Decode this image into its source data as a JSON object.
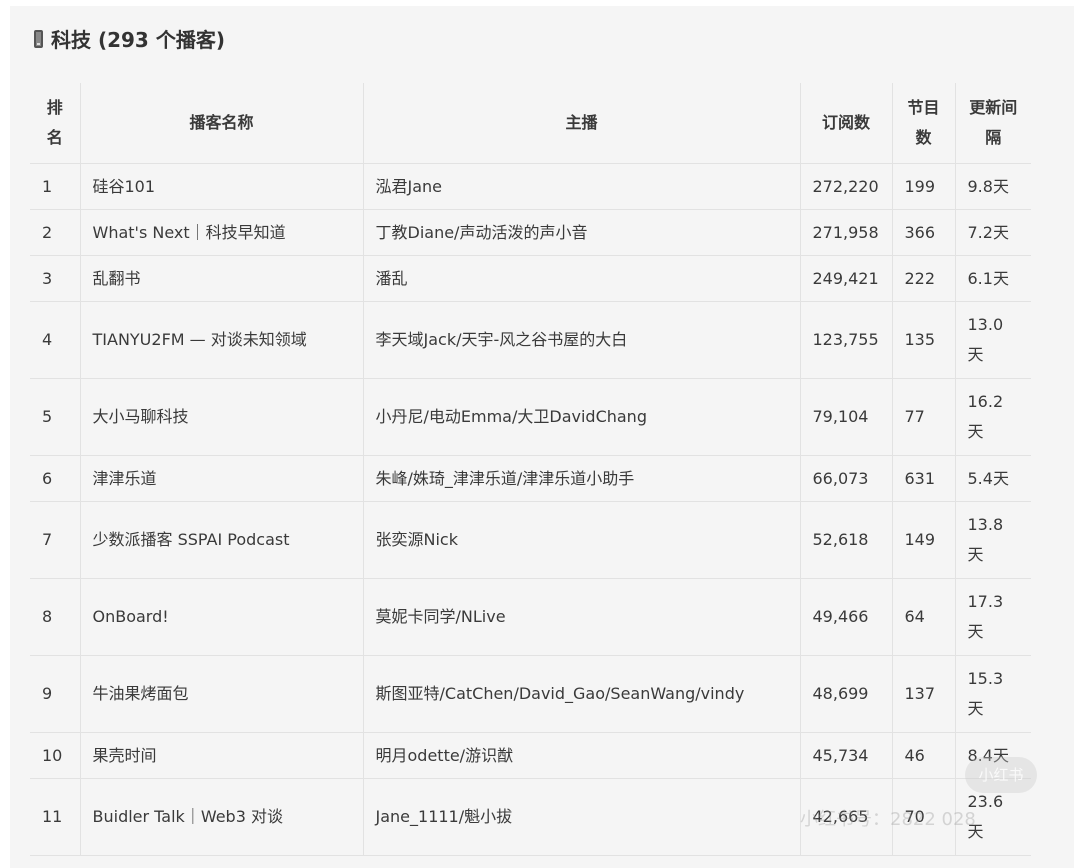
{
  "title": {
    "icon": "mobile-phone-icon",
    "text": "科技 (293 个播客)"
  },
  "table": {
    "headers": {
      "rank": "排名",
      "name": "播客名称",
      "host": "主播",
      "subscribers": "订阅数",
      "episodes": "节目数",
      "interval": "更新间隔"
    },
    "rows": [
      {
        "rank": "1",
        "name": "硅谷101",
        "host": "泓君Jane",
        "subscribers": "272,220",
        "episodes": "199",
        "interval": "9.8天"
      },
      {
        "rank": "2",
        "name": "What's Next｜科技早知道",
        "host": "丁教Diane/声动活泼的声小音",
        "subscribers": "271,958",
        "episodes": "366",
        "interval": "7.2天"
      },
      {
        "rank": "3",
        "name": "乱翻书",
        "host": "潘乱",
        "subscribers": "249,421",
        "episodes": "222",
        "interval": "6.1天"
      },
      {
        "rank": "4",
        "name": "TIANYU2FM — 对谈未知领域",
        "host": "李天域Jack/天宇-风之谷书屋的大白",
        "subscribers": "123,755",
        "episodes": "135",
        "interval": "13.0天"
      },
      {
        "rank": "5",
        "name": "大小马聊科技",
        "host": "小丹尼/电动Emma/大卫DavidChang",
        "subscribers": "79,104",
        "episodes": "77",
        "interval": "16.2天"
      },
      {
        "rank": "6",
        "name": "津津乐道",
        "host": "朱峰/姝琦_津津乐道/津津乐道小助手",
        "subscribers": "66,073",
        "episodes": "631",
        "interval": "5.4天"
      },
      {
        "rank": "7",
        "name": "少数派播客 SSPAI Podcast",
        "host": "张奕源Nick",
        "subscribers": "52,618",
        "episodes": "149",
        "interval": "13.8天"
      },
      {
        "rank": "8",
        "name": "OnBoard!",
        "host": "莫妮卡同学/NLive",
        "subscribers": "49,466",
        "episodes": "64",
        "interval": "17.3天"
      },
      {
        "rank": "9",
        "name": "牛油果烤面包",
        "host": "斯图亚特/CatChen/David_Gao/SeanWang/vindy",
        "subscribers": "48,699",
        "episodes": "137",
        "interval": "15.3天"
      },
      {
        "rank": "10",
        "name": "果壳时间",
        "host": "明月odette/游识猷",
        "subscribers": "45,734",
        "episodes": "46",
        "interval": "8.4天"
      },
      {
        "rank": "11",
        "name": "Buidler Talk｜Web3 对谈",
        "host": "Jane_1111/魁小拔",
        "subscribers": "42,665",
        "episodes": "70",
        "interval": "23.6天"
      }
    ]
  },
  "watermark": {
    "logo": "小红书",
    "text": "小红书号：2822 028"
  }
}
